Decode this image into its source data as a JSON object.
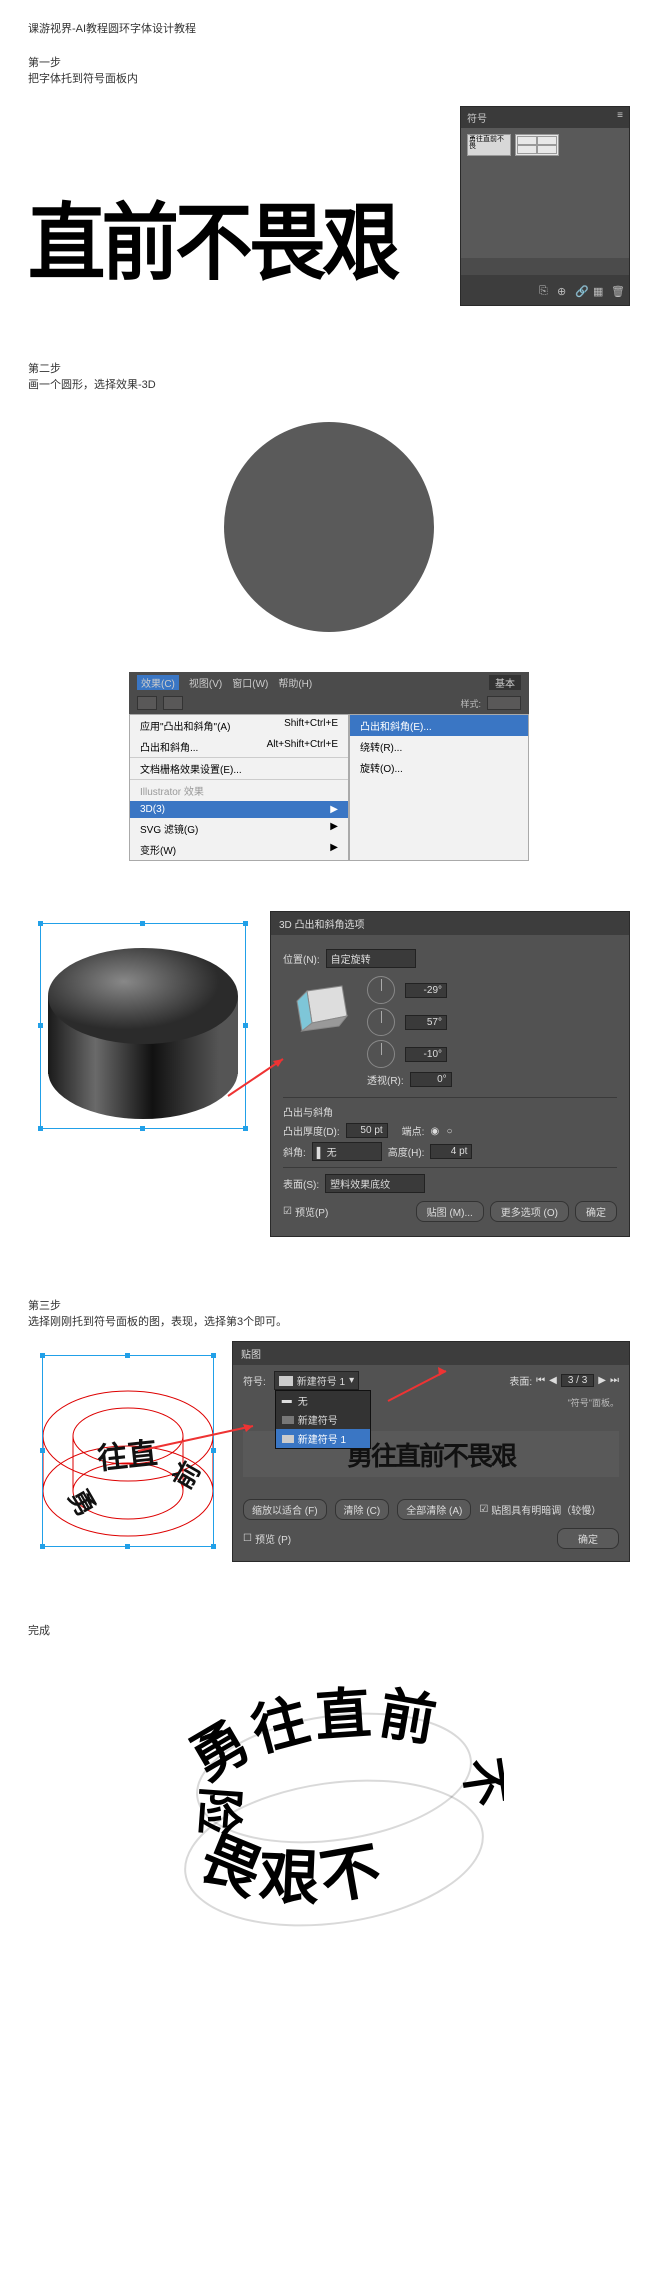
{
  "title": "课游视界-AI教程圆环字体设计教程",
  "step1": {
    "label": "第一步",
    "desc": "把字体托到符号面板内",
    "big_text": "直前不畏艰",
    "panel_title": "符号"
  },
  "step2": {
    "label": "第二步",
    "desc": "画一个圆形，选择效果-3D",
    "menubar": [
      "效果(C)",
      "视图(V)",
      "窗口(W)",
      "帮助(H)"
    ],
    "menubar_extra": "基本",
    "toolbar_label": "样式:",
    "menu1": [
      {
        "label": "应用\"凸出和斜角\"(A)",
        "shortcut": "Shift+Ctrl+E"
      },
      {
        "label": "凸出和斜角...",
        "shortcut": "Alt+Shift+Ctrl+E"
      },
      {
        "label": "文档栅格效果设置(E)...",
        "shortcut": "",
        "sep": true
      },
      {
        "label": "Illustrator 效果",
        "shortcut": "",
        "disabled": true,
        "sep": true
      },
      {
        "label": "3D(3)",
        "shortcut": "▶",
        "selected": true
      },
      {
        "label": "SVG 滤镜(G)",
        "shortcut": "▶"
      },
      {
        "label": "变形(W)",
        "shortcut": "▶"
      }
    ],
    "menu2": [
      {
        "label": "凸出和斜角(E)...",
        "selected": true
      },
      {
        "label": "绕转(R)..."
      },
      {
        "label": "旋转(O)..."
      }
    ],
    "dialog": {
      "title": "3D 凸出和斜角选项",
      "pos_label": "位置(N):",
      "pos_value": "自定旋转",
      "rot_x": "-29°",
      "rot_y": "57°",
      "rot_z": "-10°",
      "persp_label": "透视(R):",
      "persp_value": "0°",
      "section1": "凸出与斜角",
      "depth_label": "凸出厚度(D):",
      "depth_value": "50 pt",
      "cap_label": "端点:",
      "bevel_label": "斜角:",
      "bevel_value": "无",
      "bevel_h_label": "高度(H):",
      "bevel_h_value": "4 pt",
      "surface_label": "表面(S):",
      "surface_value": "塑料效果底纹",
      "preview": "预览(P)",
      "map": "贴图 (M)...",
      "more": "更多选项 (O)",
      "ok": "确定"
    }
  },
  "step3": {
    "label": "第三步",
    "desc": "选择刚刚托到符号面板的图，表现，选择第3个即可。",
    "panel_title": "贴图",
    "sym_label": "符号:",
    "sym_value": "新建符号 1",
    "dd_items": [
      "无",
      "新建符号",
      "新建符号 1"
    ],
    "face_label": "表面:",
    "face_value": "3 / 3",
    "tip": "\"符号\"面板。",
    "preview_text": "勇往直前不畏艰",
    "fit_btn": "缩放以适合 (F)",
    "clear_btn": "清除 (C)",
    "clear_all_btn": "全部清除 (A)",
    "chk1": "贴图具有明暗调（较慢）",
    "chk2": "预览 (P)",
    "ok": "确定"
  },
  "final": {
    "label": "完成"
  }
}
